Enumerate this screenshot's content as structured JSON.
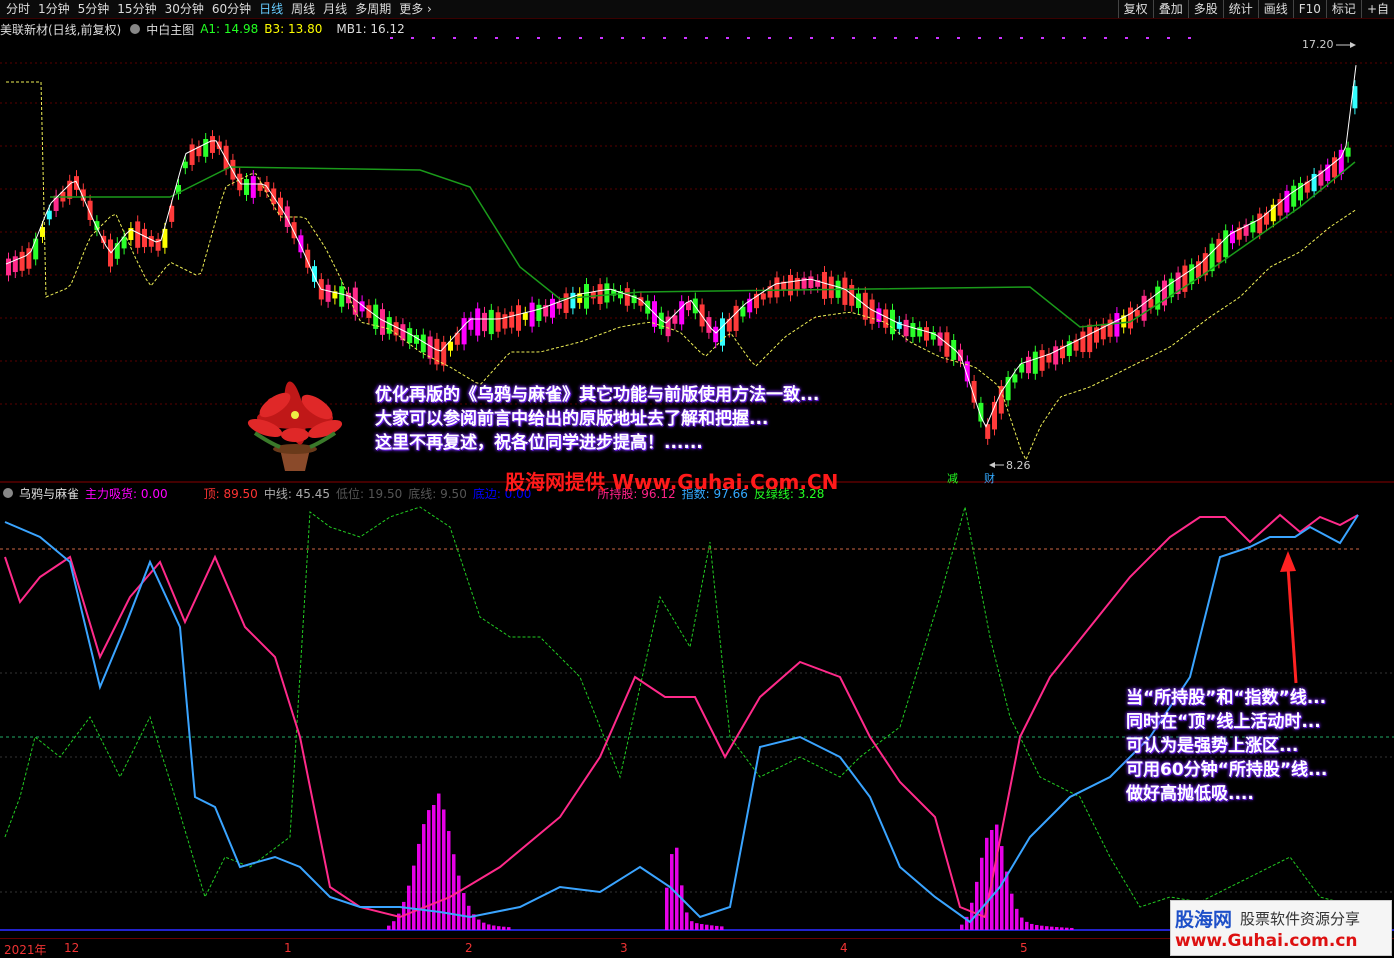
{
  "toolbar": {
    "periods": [
      "分时",
      "1分钟",
      "5分钟",
      "15分钟",
      "30分钟",
      "60分钟",
      "日线",
      "周线",
      "月线",
      "多周期",
      "更多"
    ],
    "active_period": "日线",
    "right_buttons": [
      "复权",
      "叠加",
      "多股",
      "统计",
      "画线",
      "F10",
      "标记",
      "+自"
    ]
  },
  "main_header": {
    "stock": "美联新材(日线,前复权)",
    "indicator": "中白主图",
    "a1": "A1: 14.98",
    "b3": "B3: 13.80",
    "mb1": "MB1: 16.12"
  },
  "main_price": {
    "high_label": "17.20",
    "low_label": "8.26"
  },
  "markers": {
    "left": "减",
    "right": "财"
  },
  "sub_header": {
    "name": "乌鸦与麻雀",
    "main_absorb": "主力吸货: 0.00",
    "top": "顶: 89.50",
    "mid": "中线: 45.45",
    "low": "低位: 19.50",
    "bottom_line": "底线: 9.50",
    "bottom_edge": "底边: 0.00",
    "held": "所持股: 96.12",
    "index": "指数: 97.66",
    "green_line": "反绿线: 3.28"
  },
  "overlay_top": [
    "优化再版的《乌鸦与麻雀》其它功能与前版使用方法一致...",
    "大家可以参阅前言中给出的原版地址去了解和把握...",
    "这里不再复述，祝各位同学进步提高！......"
  ],
  "overlay_right": [
    "当“所持股”和“指数”线...",
    "同时在“顶”线上活动时...",
    "可认为是强势上涨区...",
    "可用60分钟“所持股”线...",
    "做好高抛低吸...."
  ],
  "watermark": "股海网提供 Www.Guhai.Com.CN",
  "logo": {
    "brand": "股海网",
    "slogan": "股票软件资源分享",
    "url": "www.Guhai.com.cn"
  },
  "date_axis": [
    "2021年",
    "12",
    "1",
    "2",
    "3",
    "4",
    "5"
  ],
  "colors": {
    "up": "#ff3a3a",
    "down": "#2aff2a",
    "pink": "#ff2a8a",
    "blue": "#3aa4ff",
    "cyan": "#3ff",
    "yellow": "#ff0",
    "magenta": "#f0f"
  }
}
